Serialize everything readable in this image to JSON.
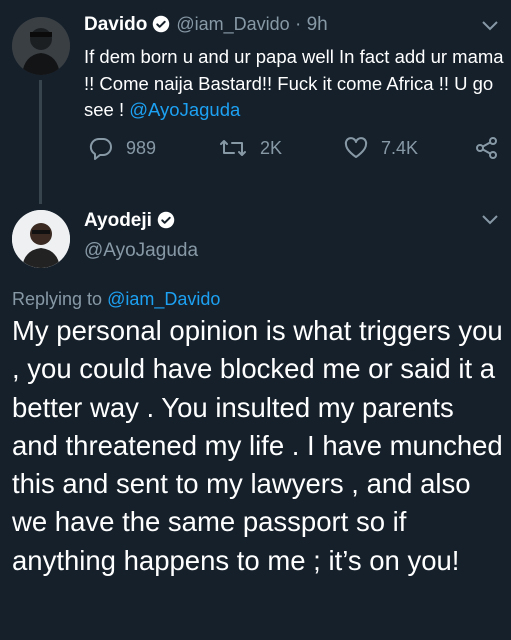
{
  "tweet1": {
    "name": "Davido",
    "handle": "@iam_Davido",
    "separator": "·",
    "time": "9h",
    "text": "If dem born u and ur papa well In fact add ur mama !! Come naija Bastard!! Fuck it come Africa !! U go see !",
    "mention": "@AyoJaguda",
    "replies": "989",
    "retweets": "2K",
    "likes": "7.4K"
  },
  "tweet2": {
    "name": "Ayodeji",
    "handle": "@AyoJaguda",
    "replying_prefix": "Replying to",
    "replying_to": "@iam_Davido",
    "text": "My personal opinion is what triggers you , you could have blocked me or said it a better way . You insulted my parents and threatened my life . I have munched this and sent to my lawyers , and also we have the same passport so if anything happens to me ; it’s on you!"
  },
  "icons": {
    "verified": "verified-badge-icon",
    "reply": "reply-bubble-icon",
    "retweet": "retweet-arrows-icon",
    "like": "heart-icon",
    "share": "share-icon",
    "more": "chevron-down-icon"
  },
  "colors": {
    "background": "#15202b",
    "text": "#ffffff",
    "muted": "#8899a6",
    "link": "#1da1f2",
    "divider": "#38444d"
  }
}
